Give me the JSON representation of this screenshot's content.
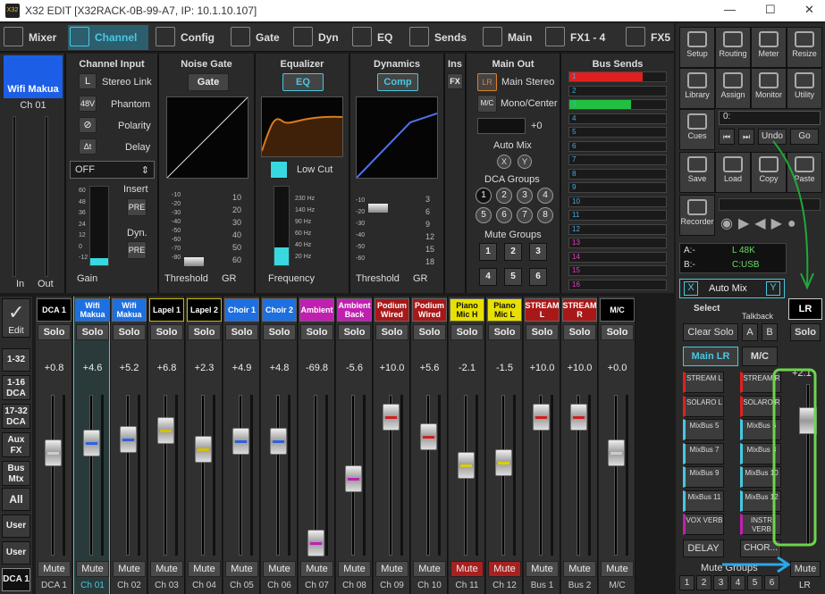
{
  "window": {
    "title": "X32 EDIT [X32RACK-0B-99-A7, IP: 10.1.10.107]",
    "logo": "X32 Edit"
  },
  "tabs": [
    {
      "label": "Mixer"
    },
    {
      "label": "Channel"
    },
    {
      "label": "Config"
    },
    {
      "label": "Gate"
    },
    {
      "label": "Dyn"
    },
    {
      "label": "EQ"
    },
    {
      "label": "Sends"
    },
    {
      "label": "Main"
    },
    {
      "label": "FX1 - 4"
    },
    {
      "label": "FX5"
    }
  ],
  "channel": {
    "name": "Wifi Makua",
    "id": "Ch 01",
    "in_label": "In",
    "out_label": "Out",
    "input": {
      "title": "Channel Input",
      "stereo_link": "Stereo Link",
      "phantom_btn": "48V",
      "phantom": "Phantom",
      "polarity": "Polarity",
      "delay": "Delay",
      "source": "OFF",
      "insert": "Insert",
      "pre1": "PRE",
      "dyn": "Dyn.",
      "pre2": "PRE",
      "gain": "Gain",
      "L": "L",
      "dt": "Δt"
    },
    "gate": {
      "title": "Noise Gate",
      "btn": "Gate",
      "threshold": "Threshold",
      "gr": "GR"
    },
    "eq": {
      "title": "Equalizer",
      "btn": "EQ",
      "lowcut": "Low Cut",
      "frequency": "Frequency"
    },
    "dyn": {
      "title": "Dynamics",
      "btn": "Comp",
      "threshold": "Threshold",
      "gr": "GR"
    },
    "ins": {
      "title": "Ins",
      "fx": "FX"
    },
    "main_out": {
      "title": "Main Out",
      "lr": "LR",
      "main_stereo": "Main Stereo",
      "mc": "M/C",
      "mono_center": "Mono/Center",
      "level": "+0",
      "auto_mix": "Auto Mix",
      "x": "X",
      "y": "Y",
      "dca_groups": "DCA Groups",
      "dca": [
        "1",
        "2",
        "3",
        "4",
        "5",
        "6",
        "7",
        "8"
      ],
      "mute_groups": "Mute Groups",
      "mg": [
        "1",
        "2",
        "3",
        "4",
        "5",
        "6"
      ]
    },
    "bus_sends": {
      "title": "Bus Sends",
      "buses": [
        "1",
        "2",
        "3",
        "4",
        "5",
        "6",
        "7",
        "8",
        "9",
        "10",
        "11",
        "12",
        "13",
        "14",
        "15",
        "16"
      ],
      "levels": [
        0.95,
        0,
        0.8,
        0,
        0,
        0,
        0,
        0,
        0,
        0,
        0,
        0,
        0,
        0,
        0,
        0
      ]
    }
  },
  "scales": {
    "gain": [
      "60",
      "48",
      "36",
      "24",
      "12",
      "0",
      "-12"
    ],
    "gate": [
      "-10",
      "-20",
      "-30",
      "-40",
      "-50",
      "-60",
      "-70",
      "-80"
    ],
    "gate_gr": [
      "10",
      "20",
      "30",
      "40",
      "50",
      "60"
    ],
    "eq_freq": [
      "230 Hz",
      "140 Hz",
      "90 Hz",
      "60 Hz",
      "40 Hz",
      "20 Hz"
    ],
    "dyn": [
      "-10",
      "-20",
      "-30",
      "-40",
      "-50",
      "-60"
    ],
    "dyn_gr": [
      "3",
      "6",
      "9",
      "12",
      "15",
      "18"
    ],
    "fader_ch01": [
      "10",
      "5",
      "0",
      "-5",
      "-10",
      "-20",
      "-30",
      "-40",
      "-50"
    ],
    "fader": [
      "10",
      "5",
      "0",
      "5",
      "10",
      "20",
      "30",
      "40",
      "50"
    ]
  },
  "left_nav": {
    "edit": "Edit",
    "items": [
      "1-32",
      "1-16\nDCA",
      "17-32\nDCA",
      "Aux\nFX",
      "Bus\nMtx",
      "All",
      "User 1",
      "User 2"
    ],
    "dca1": "DCA 1"
  },
  "strips": [
    {
      "name": "DCA 1",
      "id": "DCA 1",
      "level": "+0.8",
      "color": "#000",
      "fader": 0.64,
      "mute": false,
      "cap": "#ccc"
    },
    {
      "name": "Wifi Makua",
      "id": "Ch 01",
      "level": "+4.6",
      "color": "#1e6fe0",
      "fader": 0.7,
      "mute": false,
      "cap": "#3060e0"
    },
    {
      "name": "Wifi Makua",
      "id": "Ch 02",
      "level": "+5.2",
      "color": "#1e6fe0",
      "fader": 0.72,
      "mute": false,
      "cap": "#3060e0"
    },
    {
      "name": "Lapel 1",
      "id": "Ch 03",
      "level": "+6.8",
      "color": "#c8b800",
      "fader": 0.78,
      "mute": false,
      "cap": "#d4c000"
    },
    {
      "name": "Lapel 2",
      "id": "Ch 04",
      "level": "+2.3",
      "color": "#c8b800",
      "fader": 0.66,
      "mute": false,
      "cap": "#d4c000"
    },
    {
      "name": "Choir 1",
      "id": "Ch 05",
      "level": "+4.9",
      "color": "#1e6fe0",
      "fader": 0.71,
      "mute": false,
      "cap": "#3060e0"
    },
    {
      "name": "Choir 2",
      "id": "Ch 06",
      "level": "+4.8",
      "color": "#1e6fe0",
      "fader": 0.71,
      "mute": false,
      "cap": "#3060e0"
    },
    {
      "name": "Ambient",
      "id": "Ch 07",
      "level": "-69.8",
      "color": "#c020b0",
      "fader": 0.08,
      "mute": false,
      "cap": "#c020b0"
    },
    {
      "name": "Ambient Back",
      "id": "Ch 08",
      "level": "-5.6",
      "color": "#c020b0",
      "fader": 0.48,
      "mute": false,
      "cap": "#c020b0"
    },
    {
      "name": "Podium Wired",
      "id": "Ch 09",
      "level": "+10.0",
      "color": "#a81818",
      "fader": 0.86,
      "mute": false,
      "cap": "#d02020"
    },
    {
      "name": "Podium Wired",
      "id": "Ch 10",
      "level": "+5.6",
      "color": "#a81818",
      "fader": 0.74,
      "mute": false,
      "cap": "#d02020"
    },
    {
      "name": "Piano Mic H",
      "id": "Ch 11",
      "level": "-2.1",
      "color": "#d8d000",
      "fader": 0.56,
      "mute": true,
      "cap": "#d8d000"
    },
    {
      "name": "Piano Mic L",
      "id": "Ch 12",
      "level": "-1.5",
      "color": "#d8d000",
      "fader": 0.58,
      "mute": true,
      "cap": "#d8d000"
    },
    {
      "name": "STREAM L",
      "id": "Bus 1",
      "level": "+10.0",
      "color": "#a81818",
      "fader": 0.86,
      "mute": false,
      "cap": "#d02020"
    },
    {
      "name": "STREAM R",
      "id": "Bus 2",
      "level": "+10.0",
      "color": "#a81818",
      "fader": 0.86,
      "mute": false,
      "cap": "#d02020"
    },
    {
      "name": "M/C",
      "id": "M/C",
      "level": "+0.0",
      "color": "#000",
      "fader": 0.64,
      "mute": false,
      "cap": "#ccc"
    }
  ],
  "right": {
    "setup": "Setup",
    "routing": "Routing",
    "meter": "Meter",
    "resize": "Resize",
    "library": "Library",
    "assign": "Assign",
    "monitor": "Monitor",
    "utility": "Utility",
    "cues": "Cues",
    "cue_val": "0:",
    "undo": "Undo",
    "go": "Go",
    "save": "Save",
    "load": "Load",
    "copy": "Copy",
    "paste": "Paste",
    "recorder": "Recorder",
    "status": {
      "a": "A:-",
      "l": "L  48K",
      "b": "B:-",
      "c": "C:USB"
    },
    "automix": "Auto Mix",
    "x": "X",
    "y": "Y",
    "select": "Select",
    "talkback": "Talkback",
    "lr": "LR",
    "clear_solo": "Clear Solo",
    "a": "A",
    "b": "B",
    "solo": "Solo",
    "main_lr": "Main LR",
    "mc": "M/C",
    "level": "+2.1",
    "buses": [
      "STREAM L",
      "STREAM R",
      "SOLARO L",
      "SOLARO R",
      "MixBus 5",
      "MixBus 6",
      "MixBus 7",
      "MixBus 8",
      "MixBus 9",
      "MixBus 10",
      "MixBus 11",
      "MixBus 12",
      "VOX VERB",
      "INSTR VERB"
    ],
    "delay": "DELAY",
    "chorus": "CHOR...",
    "mute": "Mute",
    "mute_groups": "Mute Groups",
    "mg": [
      "1",
      "2",
      "3",
      "4",
      "5",
      "6"
    ],
    "lr_id": "LR"
  }
}
